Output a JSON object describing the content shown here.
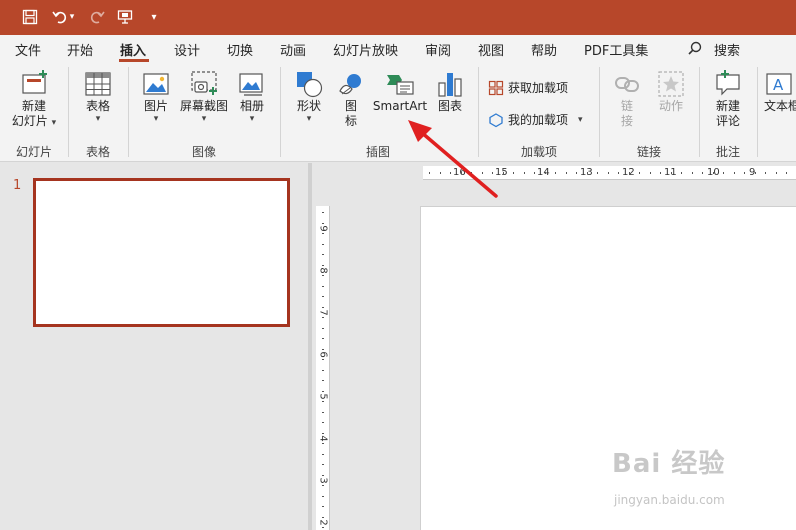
{
  "colors": {
    "accent": "#b7472a",
    "thumb_border": "#a5341f",
    "arrow": "#e02020"
  },
  "quick_access": [
    {
      "name": "save-icon"
    },
    {
      "name": "undo-icon",
      "caret": "▾"
    },
    {
      "name": "redo-icon"
    },
    {
      "name": "present-icon"
    },
    {
      "name": "customize-qat-icon",
      "caret": "▾"
    }
  ],
  "tabs": [
    {
      "label": "文件"
    },
    {
      "label": "开始"
    },
    {
      "label": "插入",
      "active": true
    },
    {
      "label": "设计"
    },
    {
      "label": "切换"
    },
    {
      "label": "动画"
    },
    {
      "label": "幻灯片放映"
    },
    {
      "label": "审阅"
    },
    {
      "label": "视图"
    },
    {
      "label": "帮助"
    },
    {
      "label": "PDF工具集"
    }
  ],
  "search": {
    "icon": "search-icon",
    "label": "搜索"
  },
  "ribbon": {
    "slides": {
      "new_slide_line1": "新建",
      "new_slide_line2": "幻灯片",
      "caret": "▾",
      "group": "幻灯片"
    },
    "tables": {
      "table": "表格",
      "caret": "▾",
      "group": "表格"
    },
    "images": {
      "pictures": "图片",
      "screenshot": "屏幕截图",
      "album": "相册",
      "caret": "▾",
      "group": "图像"
    },
    "illustrations": {
      "shapes": "形状",
      "icons_line1": "图",
      "icons_line2": "标",
      "smartart": "SmartArt",
      "chart": "图表",
      "caret": "▾",
      "group": "插图"
    },
    "addins": {
      "get": "获取加载项",
      "mine": "我的加载项",
      "caret": "▾",
      "group": "加载项"
    },
    "links": {
      "link_line1": "链",
      "link_line2": "接",
      "action": "动作",
      "group": "链接"
    },
    "comments": {
      "new_line1": "新建",
      "new_line2": "评论",
      "group": "批注"
    },
    "text": {
      "textbox": "文本框"
    }
  },
  "thumbnails": {
    "slide_number": "1"
  },
  "ruler": {
    "horizontal": [
      "16",
      "15",
      "14",
      "13",
      "12",
      "11",
      "10",
      "9"
    ],
    "vertical": [
      "9",
      "8",
      "7",
      "6",
      "5",
      "4",
      "3",
      "2"
    ]
  },
  "watermark": {
    "brand": "Bai 经验",
    "url": "jingyan.baidu.com"
  }
}
